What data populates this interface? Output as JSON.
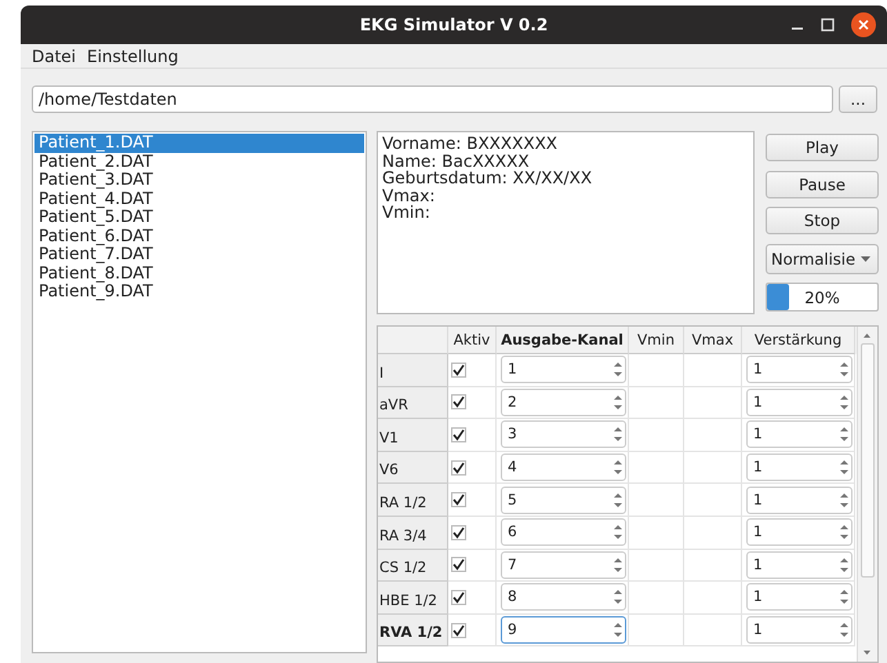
{
  "window": {
    "title": "EKG Simulator V 0.2"
  },
  "menu": [
    "Datei",
    "Einstellung"
  ],
  "path_field": {
    "value": "/home/Testdaten"
  },
  "browse_button": "...",
  "files": [
    {
      "label": "Patient_1.DAT",
      "selected": true
    },
    {
      "label": "Patient_2.DAT",
      "selected": false
    },
    {
      "label": "Patient_3.DAT",
      "selected": false
    },
    {
      "label": "Patient_4.DAT",
      "selected": false
    },
    {
      "label": "Patient_5.DAT",
      "selected": false
    },
    {
      "label": "Patient_6.DAT",
      "selected": false
    },
    {
      "label": "Patient_7.DAT",
      "selected": false
    },
    {
      "label": "Patient_8.DAT",
      "selected": false
    },
    {
      "label": "Patient_9.DAT",
      "selected": false
    }
  ],
  "info_lines": [
    "Vorname: BXXXXXXX",
    "Name: BacXXXXX",
    "Geburtsdatum: XX/XX/XX",
    "Vmax:",
    "Vmin:"
  ],
  "buttons": [
    "Play",
    "Pause",
    "Stop"
  ],
  "mode_combo": {
    "value": "Normalisie"
  },
  "progress": {
    "level": 0.2,
    "text": "20%"
  },
  "table": {
    "columns": [
      {
        "label": "Aktiv",
        "current": false
      },
      {
        "label": "Ausgabe-Kanal",
        "current": true
      },
      {
        "label": "Vmin",
        "current": false
      },
      {
        "label": "Vmax",
        "current": false
      },
      {
        "label": "Verstärkung",
        "current": false
      }
    ],
    "rows": [
      {
        "label": "I",
        "active": true,
        "channel": "1",
        "gain": "1",
        "current": false
      },
      {
        "label": "aVR",
        "active": true,
        "channel": "2",
        "gain": "1",
        "current": false
      },
      {
        "label": "V1",
        "active": true,
        "channel": "3",
        "gain": "1",
        "current": false
      },
      {
        "label": "V6",
        "active": true,
        "channel": "4",
        "gain": "1",
        "current": false
      },
      {
        "label": "RA 1/2",
        "active": true,
        "channel": "5",
        "gain": "1",
        "current": false
      },
      {
        "label": "RA 3/4",
        "active": true,
        "channel": "6",
        "gain": "1",
        "current": false
      },
      {
        "label": "CS 1/2",
        "active": true,
        "channel": "7",
        "gain": "1",
        "current": false
      },
      {
        "label": "HBE 1/2",
        "active": true,
        "channel": "8",
        "gain": "1",
        "current": false
      },
      {
        "label": "RVA 1/2",
        "active": true,
        "channel": "9",
        "gain": "1",
        "current": true
      }
    ]
  }
}
